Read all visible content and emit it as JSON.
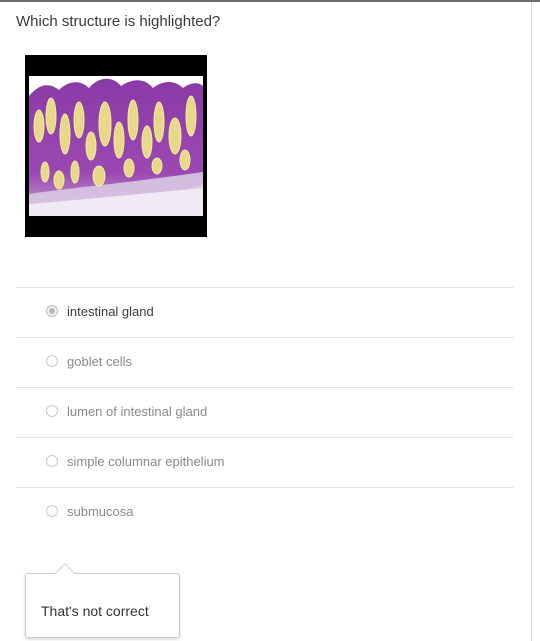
{
  "question": "Which structure is highlighted?",
  "image_icon": "histology-micrograph-icon",
  "options": [
    {
      "label": "intestinal gland",
      "selected": true
    },
    {
      "label": "goblet cells",
      "selected": false
    },
    {
      "label": "lumen of intestinal gland",
      "selected": false
    },
    {
      "label": "simple columnar epithelium",
      "selected": false
    },
    {
      "label": "submucosa",
      "selected": false
    }
  ],
  "feedback": "That's not correct"
}
